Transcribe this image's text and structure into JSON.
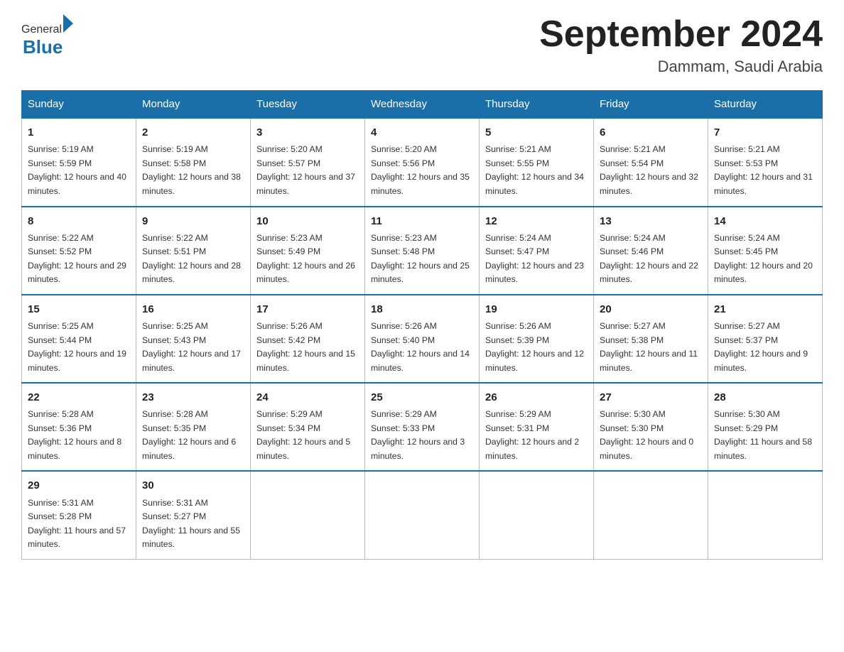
{
  "header": {
    "logo_general": "General",
    "logo_blue": "Blue",
    "month": "September 2024",
    "location": "Dammam, Saudi Arabia"
  },
  "days_of_week": [
    "Sunday",
    "Monday",
    "Tuesday",
    "Wednesday",
    "Thursday",
    "Friday",
    "Saturday"
  ],
  "weeks": [
    [
      {
        "day": "1",
        "sunrise": "5:19 AM",
        "sunset": "5:59 PM",
        "daylight": "12 hours and 40 minutes."
      },
      {
        "day": "2",
        "sunrise": "5:19 AM",
        "sunset": "5:58 PM",
        "daylight": "12 hours and 38 minutes."
      },
      {
        "day": "3",
        "sunrise": "5:20 AM",
        "sunset": "5:57 PM",
        "daylight": "12 hours and 37 minutes."
      },
      {
        "day": "4",
        "sunrise": "5:20 AM",
        "sunset": "5:56 PM",
        "daylight": "12 hours and 35 minutes."
      },
      {
        "day": "5",
        "sunrise": "5:21 AM",
        "sunset": "5:55 PM",
        "daylight": "12 hours and 34 minutes."
      },
      {
        "day": "6",
        "sunrise": "5:21 AM",
        "sunset": "5:54 PM",
        "daylight": "12 hours and 32 minutes."
      },
      {
        "day": "7",
        "sunrise": "5:21 AM",
        "sunset": "5:53 PM",
        "daylight": "12 hours and 31 minutes."
      }
    ],
    [
      {
        "day": "8",
        "sunrise": "5:22 AM",
        "sunset": "5:52 PM",
        "daylight": "12 hours and 29 minutes."
      },
      {
        "day": "9",
        "sunrise": "5:22 AM",
        "sunset": "5:51 PM",
        "daylight": "12 hours and 28 minutes."
      },
      {
        "day": "10",
        "sunrise": "5:23 AM",
        "sunset": "5:49 PM",
        "daylight": "12 hours and 26 minutes."
      },
      {
        "day": "11",
        "sunrise": "5:23 AM",
        "sunset": "5:48 PM",
        "daylight": "12 hours and 25 minutes."
      },
      {
        "day": "12",
        "sunrise": "5:24 AM",
        "sunset": "5:47 PM",
        "daylight": "12 hours and 23 minutes."
      },
      {
        "day": "13",
        "sunrise": "5:24 AM",
        "sunset": "5:46 PM",
        "daylight": "12 hours and 22 minutes."
      },
      {
        "day": "14",
        "sunrise": "5:24 AM",
        "sunset": "5:45 PM",
        "daylight": "12 hours and 20 minutes."
      }
    ],
    [
      {
        "day": "15",
        "sunrise": "5:25 AM",
        "sunset": "5:44 PM",
        "daylight": "12 hours and 19 minutes."
      },
      {
        "day": "16",
        "sunrise": "5:25 AM",
        "sunset": "5:43 PM",
        "daylight": "12 hours and 17 minutes."
      },
      {
        "day": "17",
        "sunrise": "5:26 AM",
        "sunset": "5:42 PM",
        "daylight": "12 hours and 15 minutes."
      },
      {
        "day": "18",
        "sunrise": "5:26 AM",
        "sunset": "5:40 PM",
        "daylight": "12 hours and 14 minutes."
      },
      {
        "day": "19",
        "sunrise": "5:26 AM",
        "sunset": "5:39 PM",
        "daylight": "12 hours and 12 minutes."
      },
      {
        "day": "20",
        "sunrise": "5:27 AM",
        "sunset": "5:38 PM",
        "daylight": "12 hours and 11 minutes."
      },
      {
        "day": "21",
        "sunrise": "5:27 AM",
        "sunset": "5:37 PM",
        "daylight": "12 hours and 9 minutes."
      }
    ],
    [
      {
        "day": "22",
        "sunrise": "5:28 AM",
        "sunset": "5:36 PM",
        "daylight": "12 hours and 8 minutes."
      },
      {
        "day": "23",
        "sunrise": "5:28 AM",
        "sunset": "5:35 PM",
        "daylight": "12 hours and 6 minutes."
      },
      {
        "day": "24",
        "sunrise": "5:29 AM",
        "sunset": "5:34 PM",
        "daylight": "12 hours and 5 minutes."
      },
      {
        "day": "25",
        "sunrise": "5:29 AM",
        "sunset": "5:33 PM",
        "daylight": "12 hours and 3 minutes."
      },
      {
        "day": "26",
        "sunrise": "5:29 AM",
        "sunset": "5:31 PM",
        "daylight": "12 hours and 2 minutes."
      },
      {
        "day": "27",
        "sunrise": "5:30 AM",
        "sunset": "5:30 PM",
        "daylight": "12 hours and 0 minutes."
      },
      {
        "day": "28",
        "sunrise": "5:30 AM",
        "sunset": "5:29 PM",
        "daylight": "11 hours and 58 minutes."
      }
    ],
    [
      {
        "day": "29",
        "sunrise": "5:31 AM",
        "sunset": "5:28 PM",
        "daylight": "11 hours and 57 minutes."
      },
      {
        "day": "30",
        "sunrise": "5:31 AM",
        "sunset": "5:27 PM",
        "daylight": "11 hours and 55 minutes."
      },
      null,
      null,
      null,
      null,
      null
    ]
  ],
  "labels": {
    "sunrise_prefix": "Sunrise: ",
    "sunset_prefix": "Sunset: ",
    "daylight_prefix": "Daylight: "
  }
}
